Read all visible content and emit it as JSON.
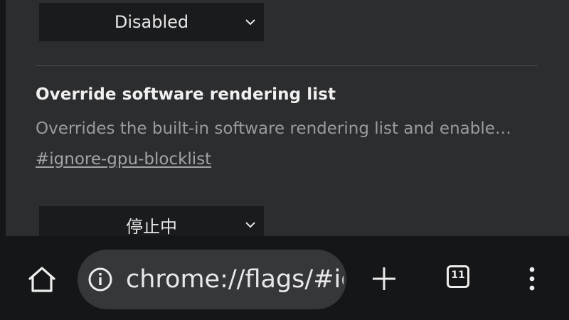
{
  "flags": {
    "previous_select": {
      "value": "Disabled"
    },
    "override_software_rendering": {
      "title": "Override software rendering list",
      "description": "Overrides the built-in software rendering list and enable…",
      "link": "#ignore-gpu-blocklist",
      "select_value": "停止中"
    }
  },
  "toolbar": {
    "url": "chrome://flags/#ignore-gpu-blocklist",
    "tab_count": "11",
    "icons": [
      "home-icon",
      "info-icon",
      "plus-icon",
      "tab-switcher-icon",
      "more-vert-icon"
    ]
  },
  "colors": {
    "background": "#2c2d2f",
    "select_bg": "#1a1b1d",
    "toolbar_bg": "#151617",
    "omnibox_bg": "#35373b"
  }
}
